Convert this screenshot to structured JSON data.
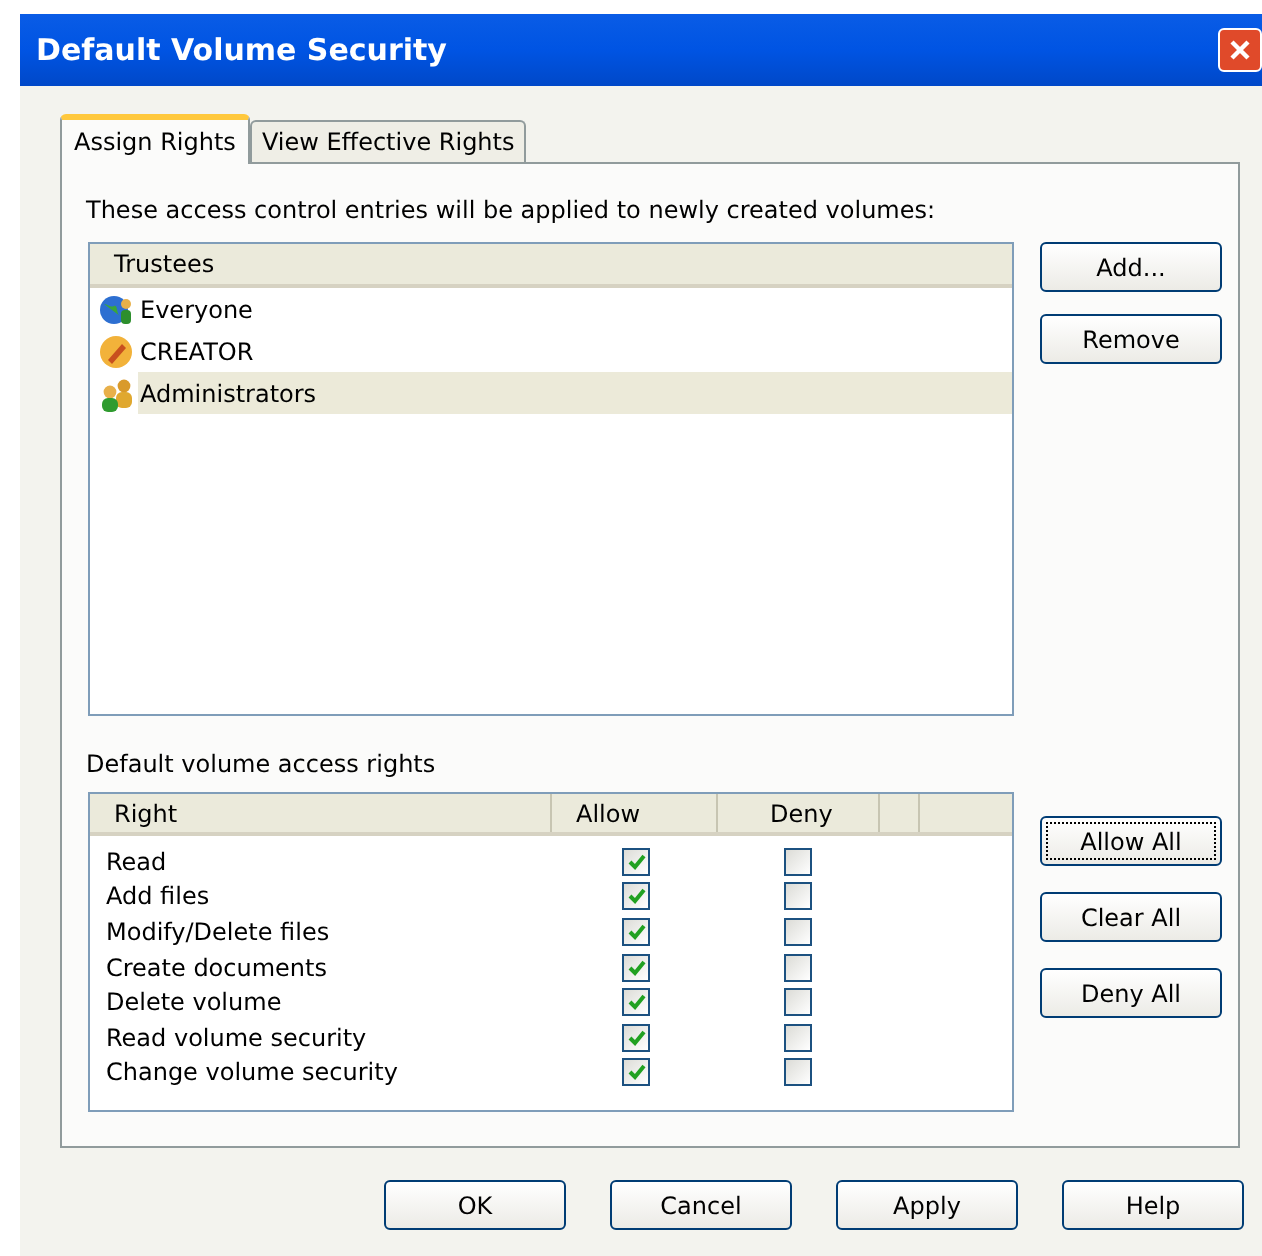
{
  "window": {
    "title": "Default Volume Security"
  },
  "tabs": [
    {
      "label": "Assign Rights",
      "selected": true
    },
    {
      "label": "View Effective Rights",
      "selected": false
    }
  ],
  "intro": "These access control entries will be applied to newly created volumes:",
  "trustees": {
    "columns": [
      "Trustees"
    ],
    "rows": [
      {
        "name": "Everyone",
        "kind": "group",
        "selected": false
      },
      {
        "name": "CREATOR",
        "kind": "creator",
        "selected": false
      },
      {
        "name": "Administrators",
        "kind": "users",
        "selected": true
      }
    ]
  },
  "trustee_buttons": [
    "Add...",
    "Remove"
  ],
  "rights_label": "Default volume access rights",
  "rights": {
    "columns": [
      "Right",
      "Allow",
      "Deny"
    ],
    "rows": [
      {
        "name": "Read",
        "allow": true,
        "deny": false
      },
      {
        "name": "Add files",
        "allow": true,
        "deny": false
      },
      {
        "name": "Modify/Delete files",
        "allow": true,
        "deny": false
      },
      {
        "name": "Create documents",
        "allow": true,
        "deny": false
      },
      {
        "name": "Delete volume",
        "allow": true,
        "deny": false
      },
      {
        "name": "Read volume security",
        "allow": true,
        "deny": false
      },
      {
        "name": "Change volume security",
        "allow": true,
        "deny": false
      }
    ]
  },
  "rights_buttons": [
    {
      "label": "Allow All",
      "focused": true
    },
    {
      "label": "Clear All",
      "focused": false
    },
    {
      "label": "Deny All",
      "focused": false
    }
  ],
  "dialog_buttons": [
    "OK",
    "Cancel",
    "Apply",
    "Help"
  ]
}
